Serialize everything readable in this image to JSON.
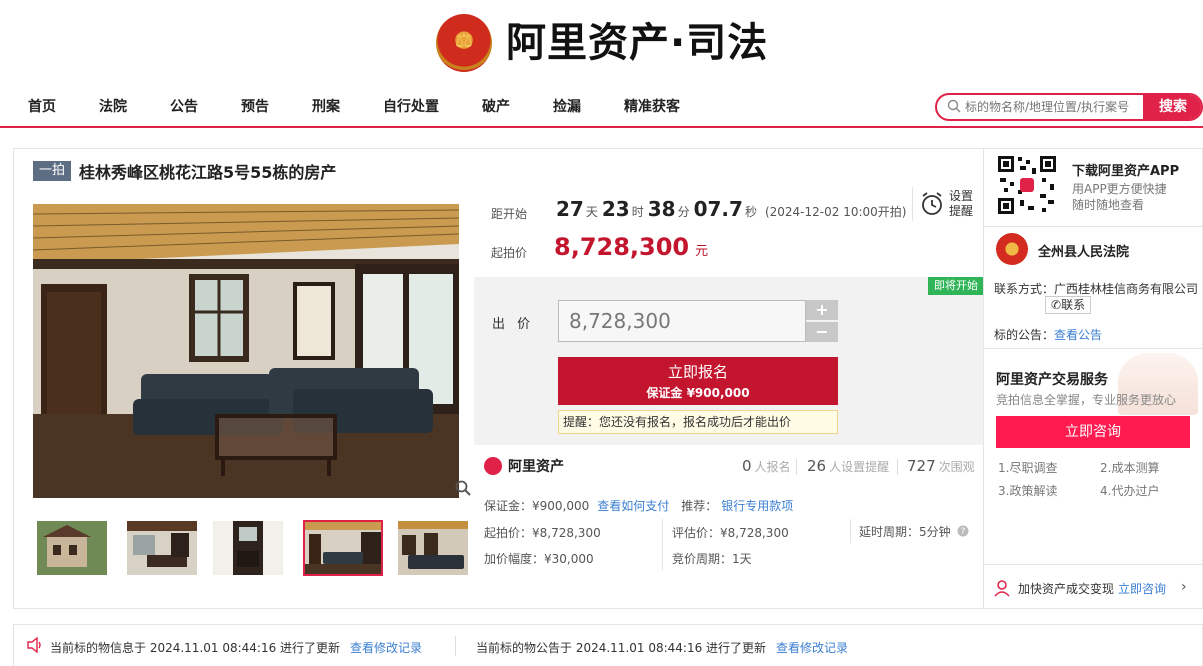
{
  "brand": {
    "name": "阿里资产·司法"
  },
  "nav": {
    "items": [
      "首页",
      "法院",
      "公告",
      "预告",
      "刑案",
      "自行处置",
      "破产",
      "捡漏",
      "精准获客"
    ],
    "search_placeholder": "标的物名称/地理位置/执行案号",
    "search_button": "搜索"
  },
  "item": {
    "round": "一拍",
    "title": "桂林秀峰区桃花江路5号55栋的房产"
  },
  "countdown": {
    "label": "距开始",
    "days": "27",
    "days_unit": "天",
    "hours": "23",
    "hours_unit": "时",
    "minutes": "38",
    "minutes_unit": "分",
    "seconds": "07.7",
    "seconds_unit": "秒",
    "start_time": "(2024-12-02 10:00开拍)"
  },
  "reminder": {
    "line1": "设置",
    "line2": "提醒"
  },
  "starting_price": {
    "label": "起拍价",
    "value": "8,728,300",
    "unit": "元"
  },
  "bid": {
    "status_badge": "即将开始",
    "label": "出 价",
    "value": "8,728,300",
    "plus": "+",
    "minus": "−",
    "signup_label": "立即报名",
    "deposit_label": "保证金 ¥900,000",
    "tip": "提醒：您还没有报名，报名成功后才能出价"
  },
  "stats": {
    "logo_text": "阿里资产",
    "signups": "0",
    "signups_unit": "人报名",
    "reminders": "26",
    "reminders_unit": "人设置提醒",
    "views": "727",
    "views_unit": "次围观"
  },
  "details": {
    "deposit": "保证金：¥900,000",
    "deposit_link": "查看如何支付",
    "recommend": "推荐：",
    "recommend_link": "银行专用款项",
    "starting": "起拍价：¥8,728,300",
    "appraisal": "评估价：¥8,728,300",
    "delay": "延时周期：5分钟",
    "increment": "加价幅度：¥30,000",
    "cycle": "竞价周期：1天"
  },
  "sidebar": {
    "app_title": "下载阿里资产APP",
    "app_sub1": "用APP更方便快捷",
    "app_sub2": "随时随地查看",
    "court_name": "全州县人民法院",
    "contact": "联系方式：广西桂林桂信商务有限公司",
    "contact_button": "联系",
    "notice_label": "标的公告：",
    "notice_link": "查看公告",
    "service_title": "阿里资产交易服务",
    "service_sub": "竞拍信息全掌握，专业服务更放心",
    "consult_button": "立即咨询",
    "service_items": [
      "1.尽职调查",
      "2.成本测算",
      "3.政策解读",
      "4.代办过户"
    ],
    "fast_text": "加快资产成交变现",
    "fast_link": "立即咨询"
  },
  "bottom": {
    "info_update": "当前标的物信息于 2024.11.01 08:44:16 进行了更新",
    "info_link": "查看修改记录",
    "notice_update": "当前标的物公告于 2024.11.01 08:44:16 进行了更新",
    "notice_link": "查看修改记录"
  }
}
